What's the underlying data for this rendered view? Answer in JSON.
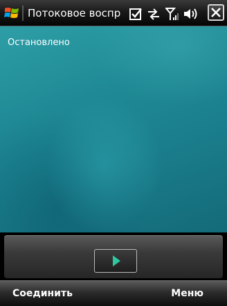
{
  "title_bar": {
    "app_title": "Потоковое воспр",
    "icons": [
      "windows-start-icon",
      "tasks-check-icon",
      "connectivity-arrows-icon",
      "signal-strength-icon",
      "speaker-volume-icon",
      "close-icon"
    ]
  },
  "main": {
    "status_text": "Остановлено"
  },
  "controls": {
    "play_icon": "play-icon",
    "play_color": "#2fc79f"
  },
  "softkeys": {
    "left_label": "Соединить",
    "right_label": "Меню"
  },
  "colors": {
    "background_teal": "#1f8a95",
    "bar_dark": "#1a1a1a"
  }
}
